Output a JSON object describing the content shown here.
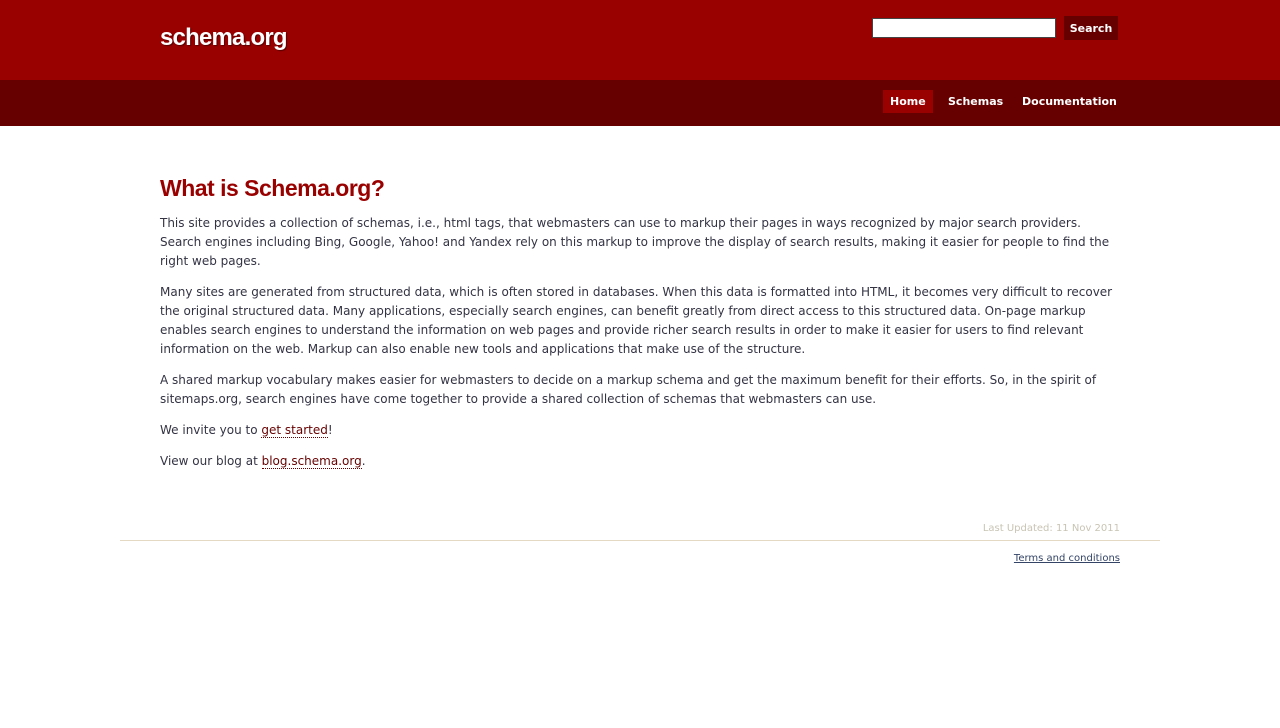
{
  "header": {
    "site_title": "schema.org",
    "search": {
      "value": "",
      "placeholder": "",
      "button_label": "Search"
    }
  },
  "nav": {
    "tabs": [
      {
        "label": "Home",
        "active": true
      },
      {
        "label": "Schemas",
        "active": false
      },
      {
        "label": "Documentation",
        "active": false
      }
    ]
  },
  "main": {
    "title": "What is Schema.org?",
    "paragraphs": [
      "This site provides a collection of schemas, i.e., html tags, that webmasters can use to markup their pages in ways recognized by major search providers. Search engines including Bing, Google, Yahoo! and Yandex rely on this markup to improve the display of search results, making it easier for people to find the right web pages.",
      "Many sites are generated from structured data, which is often stored in databases. When this data is formatted into HTML, it becomes very difficult to recover the original structured data. Many applications, especially search engines, can benefit greatly from direct access to this structured data. On-page markup enables search engines to understand the information on web pages and provide richer search results in order to make it easier for users to find relevant information on the web. Markup can also enable new tools and applications that make use of the structure.",
      "A shared markup vocabulary makes easier for webmasters to decide on a markup schema and get the maximum benefit for their efforts. So, in the spirit of sitemaps.org, search engines have come together to provide a shared collection of schemas that webmasters can use."
    ],
    "invite": {
      "prefix": "We invite you to ",
      "link_text": "get started",
      "suffix": "!"
    },
    "blog": {
      "prefix": "View our blog at ",
      "link_text": "blog.schema.org",
      "suffix": "."
    }
  },
  "footer": {
    "last_updated": "Last Updated: 11 Nov 2011",
    "terms_label": "Terms and conditions"
  },
  "colors": {
    "header_red": "#990000",
    "nav_dark_red": "#660000",
    "active_tab": "#990000",
    "title_red": "#990000",
    "body_text": "#333344",
    "link": "#660000",
    "footer_text": "#c8c4b4",
    "footer_rule": "#e4dac4"
  },
  "icons": []
}
